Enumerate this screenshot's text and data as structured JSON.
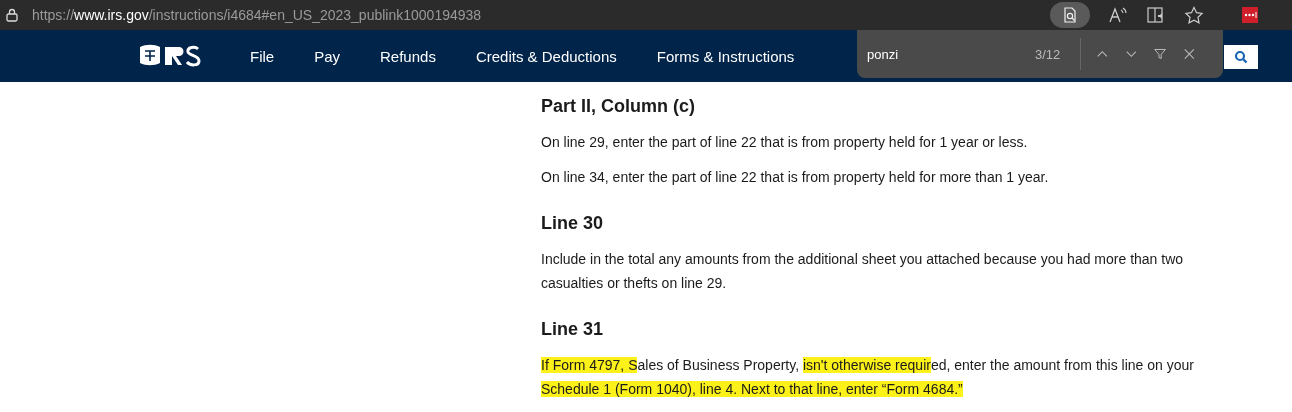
{
  "browser": {
    "url": {
      "scheme": "https://",
      "host": "www.irs.gov",
      "path": "/instructions/i4684#en_US_2023_publink1000194938"
    },
    "find_active": true
  },
  "nav": {
    "items": [
      {
        "label": "File"
      },
      {
        "label": "Pay"
      },
      {
        "label": "Refunds"
      },
      {
        "label": "Credits & Deductions"
      },
      {
        "label": "Forms & Instructions"
      }
    ]
  },
  "find_bar": {
    "value": "ponzi",
    "count": "3/12"
  },
  "sections": [
    {
      "heading": "Part II, Column (c)",
      "paragraphs": [
        [
          {
            "text": "On line 29, enter the part of line 22 that is from property held for 1 year or less.",
            "highlighted": false
          }
        ],
        [
          {
            "text": "On line 34, enter the part of line 22 that is from property held for more than 1 year.",
            "highlighted": false
          }
        ]
      ]
    },
    {
      "heading": "Line 30",
      "paragraphs": [
        [
          {
            "text": "Include in the total any amounts from the additional sheet you attached because you had more than two casualties or thefts on line 29.",
            "highlighted": false
          }
        ]
      ]
    },
    {
      "heading": "Line 31",
      "paragraphs": [
        [
          {
            "text": "If Form 4797, S",
            "highlighted": true
          },
          {
            "text": "ales of Business Property, ",
            "highlighted": false
          },
          {
            "text": "isn't otherwise requir",
            "highlighted": true
          },
          {
            "text": "ed, enter the amount from this line on your ",
            "highlighted": false
          },
          {
            "text": "Schedule 1 (Form 1040), line 4. Next to that line, enter “Form 4684.”",
            "highlighted": true
          }
        ]
      ]
    }
  ]
}
